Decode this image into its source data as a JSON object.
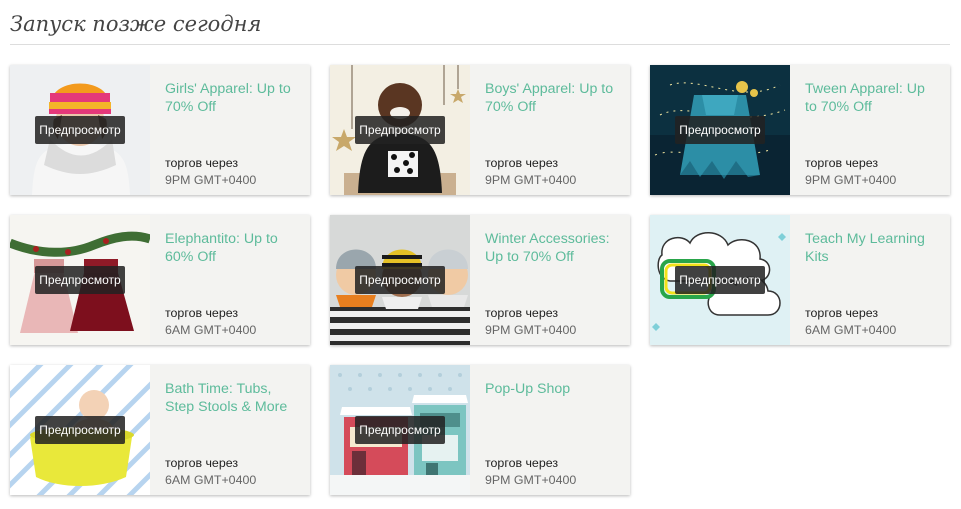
{
  "section": {
    "title": "Запуск позже сегодня"
  },
  "cards": [
    {
      "title": "Girls' Apparel: Up to 70% Off",
      "preview_label": "Предпросмотр",
      "ends_label": "торгов через",
      "ends_time": "9PM GMT+0400",
      "thumb_icon": "girl-in-hat-photo"
    },
    {
      "title": "Boys' Apparel: Up to 70% Off",
      "preview_label": "Предпросмотр",
      "ends_label": "торгов через",
      "ends_time": "9PM GMT+0400",
      "thumb_icon": "boy-with-gift-photo"
    },
    {
      "title": "Tween Apparel: Up to 70% Off",
      "preview_label": "Предпросмотр",
      "ends_label": "торгов через",
      "ends_time": "9PM GMT+0400",
      "thumb_icon": "dress-with-lights-photo"
    },
    {
      "title": "Elephantito: Up to 60% Off",
      "preview_label": "Предпросмотр",
      "ends_label": "торгов через",
      "ends_time": "6AM GMT+0400",
      "thumb_icon": "dresses-garland-photo"
    },
    {
      "title": "Winter Accessories: Up to 70% Off",
      "preview_label": "Предпросмотр",
      "ends_label": "торгов через",
      "ends_time": "9PM GMT+0400",
      "thumb_icon": "kids-in-hats-photo"
    },
    {
      "title": "Teach My Learning Kits",
      "preview_label": "Предпросмотр",
      "ends_label": "торгов через",
      "ends_time": "6AM GMT+0400",
      "thumb_icon": "learning-kit-cloud-photo"
    },
    {
      "title": "Bath Time: Tubs, Step Stools & More",
      "preview_label": "Предпросмотр",
      "ends_label": "торгов через",
      "ends_time": "6AM GMT+0400",
      "thumb_icon": "baby-bath-photo"
    },
    {
      "title": "Pop-Up Shop",
      "preview_label": "Предпросмотр",
      "ends_label": "торгов через",
      "ends_time": "9PM GMT+0400",
      "thumb_icon": "shop-storefront-photo"
    }
  ],
  "colors": {
    "accent": "#5dbb9b",
    "card_bg": "#f3f3f1",
    "preview_bg": "#222222"
  }
}
